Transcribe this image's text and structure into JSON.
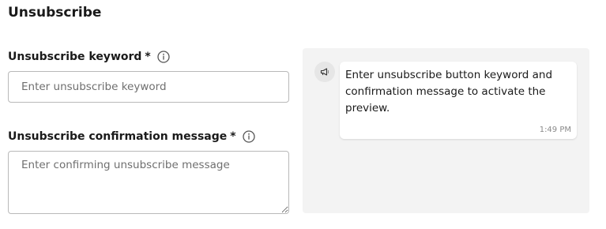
{
  "page": {
    "title": "Unsubscribe"
  },
  "form": {
    "keyword": {
      "label": "Unsubscribe keyword",
      "required_mark": "*",
      "placeholder": "Enter unsubscribe keyword",
      "value": ""
    },
    "confirmation": {
      "label": "Unsubscribe confirmation message",
      "required_mark": "*",
      "placeholder": "Enter confirming unsubscribe message",
      "value": ""
    }
  },
  "preview": {
    "message": "Enter unsubscribe button keyword and confirmation message to activate the preview.",
    "time": "1:49 PM",
    "avatar_icon": "megaphone-icon"
  },
  "colors": {
    "panel_bg": "#f3f3f3",
    "border": "#b9b9b9",
    "text": "#1a1a1a",
    "muted": "#8a8a8a"
  }
}
